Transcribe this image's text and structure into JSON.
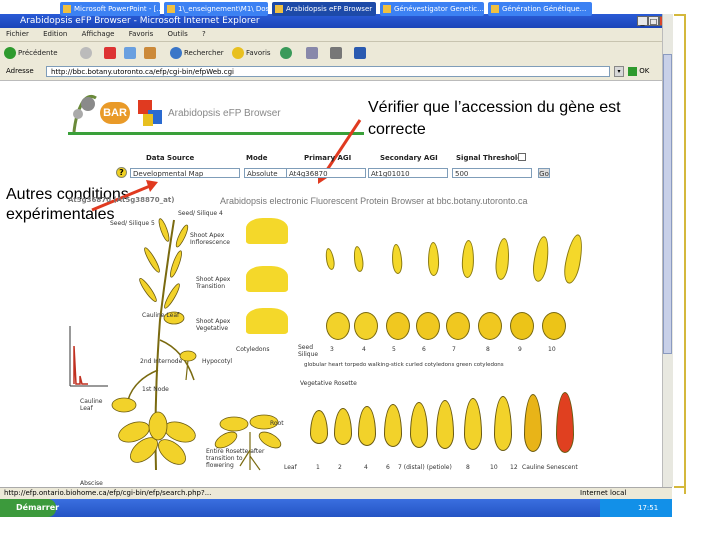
{
  "window": {
    "title": "Arabidopsis eFP Browser - Microsoft Internet Explorer",
    "min": "_",
    "max": "□",
    "close": "×"
  },
  "menu": [
    "Fichier",
    "Edition",
    "Affichage",
    "Favoris",
    "Outils",
    "?"
  ],
  "toolbar": {
    "back": "Précédente",
    "search": "Rechercher",
    "favorites": "Favoris"
  },
  "address": {
    "label": "Adresse",
    "url": "http://bbc.botany.utoronto.ca/efp/cgi-bin/efpWeb.cgi",
    "go": "OK"
  },
  "efp": {
    "bar_logo": "BAR",
    "site_title": "Arabidopsis eFP Browser",
    "headers": {
      "data_source": "Data Source",
      "mode": "Mode",
      "primary": "Primary AGI",
      "secondary": "Secondary AGI",
      "threshold": "Signal Threshold"
    },
    "help": "?",
    "data_source_value": "Developmental Map",
    "mode_value": "Absolute",
    "primary_value": "At4g36870",
    "secondary_value": "At1g01010",
    "threshold_value": "500",
    "go": "Go",
    "gene_id": "At5g36870 (At5g38870_at)",
    "banner": "Arabidopsis electronic Fluorescent Protein Browser at bbc.botany.utoronto.ca",
    "tissue_labels": {
      "seed_stage4": "Seed/ Silique 4",
      "seed_stage5": "Seed/ Silique 5",
      "shoot_apex_infl": "Shoot Apex Inflorescence",
      "shoot_apex_trans": "Shoot Apex Transition",
      "shoot_apex_veg": "Shoot Apex Vegetative",
      "cauline_leaf": "Cauline Leaf",
      "cotyledons": "Cotyledons",
      "hypocotyl": "Hypocotyl",
      "first_internode": "1st Node",
      "second_internode": "2nd Internode",
      "cauline": "Cauline Leaf",
      "root": "Root",
      "rosette": "Entire Rosette after transition to flowering",
      "vegetative_rosette": "Vegetative Rosette",
      "seed_row": "Seed Silique",
      "stage_row": "Stage:",
      "stage_numbers": [
        "3",
        "4",
        "5",
        "6",
        "7",
        "8",
        "9",
        "10"
      ],
      "stage_names": "globular heart torpedo walking-stick curled cotyledons green cotyledons",
      "leaf_row": [
        "Leaf",
        "1",
        "2",
        "4",
        "6",
        "8",
        "10",
        "12"
      ],
      "leaf_tail": "Cauline  Senescent",
      "petiole": "7 (distal)  (petiole)",
      "abscise": "Abscise"
    }
  },
  "annotations": {
    "verify": "Vérifier que l’accession du gène est correcte",
    "other": "Autres conditions expérimentales"
  },
  "status": {
    "url": "http://efp.ontario.biohome.ca/efp/cgi-bin/efp/search.php?...",
    "zone": "Internet local"
  },
  "taskbar": {
    "start": "Démarrer",
    "items": [
      "Microsoft PowerPoint - [...]",
      "1\\_enseignement\\M1\\ Dos...",
      "Arabidopsis eFP Browser",
      "Génévestigator Genetic...",
      "Génération Génétique..."
    ],
    "clock": "17:51"
  },
  "colors": {
    "accent_arrow": "#e03a20",
    "efp_yellow": "#f4d82a",
    "xp_blue": "#2454c4",
    "deco_gold": "#d4b83c"
  }
}
